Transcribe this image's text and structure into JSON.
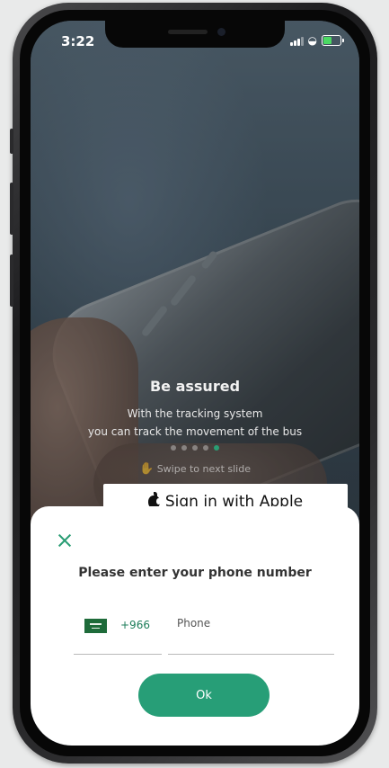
{
  "status_bar": {
    "time": "3:22"
  },
  "onboarding": {
    "title": "Be assured",
    "description_line1": "With the tracking system",
    "description_line2": "you can track the movement of the bus",
    "swipe_hint": "Swipe to next slide",
    "slide_count": 5,
    "active_slide": 4
  },
  "apple_button": {
    "label": "Sign in with Apple"
  },
  "phone_sheet": {
    "title": "Please enter your phone number",
    "country_code": "+966",
    "phone_placeholder": "Phone",
    "phone_value": "",
    "ok_label": "Ok"
  },
  "colors": {
    "accent": "#279e77",
    "flag_green": "#1e6b3a",
    "battery": "#4cd964"
  },
  "icons": {
    "close": "close-icon",
    "swipe": "swipe-hand-icon",
    "apple": "apple-icon",
    "flag": "saudi-flag-icon"
  }
}
